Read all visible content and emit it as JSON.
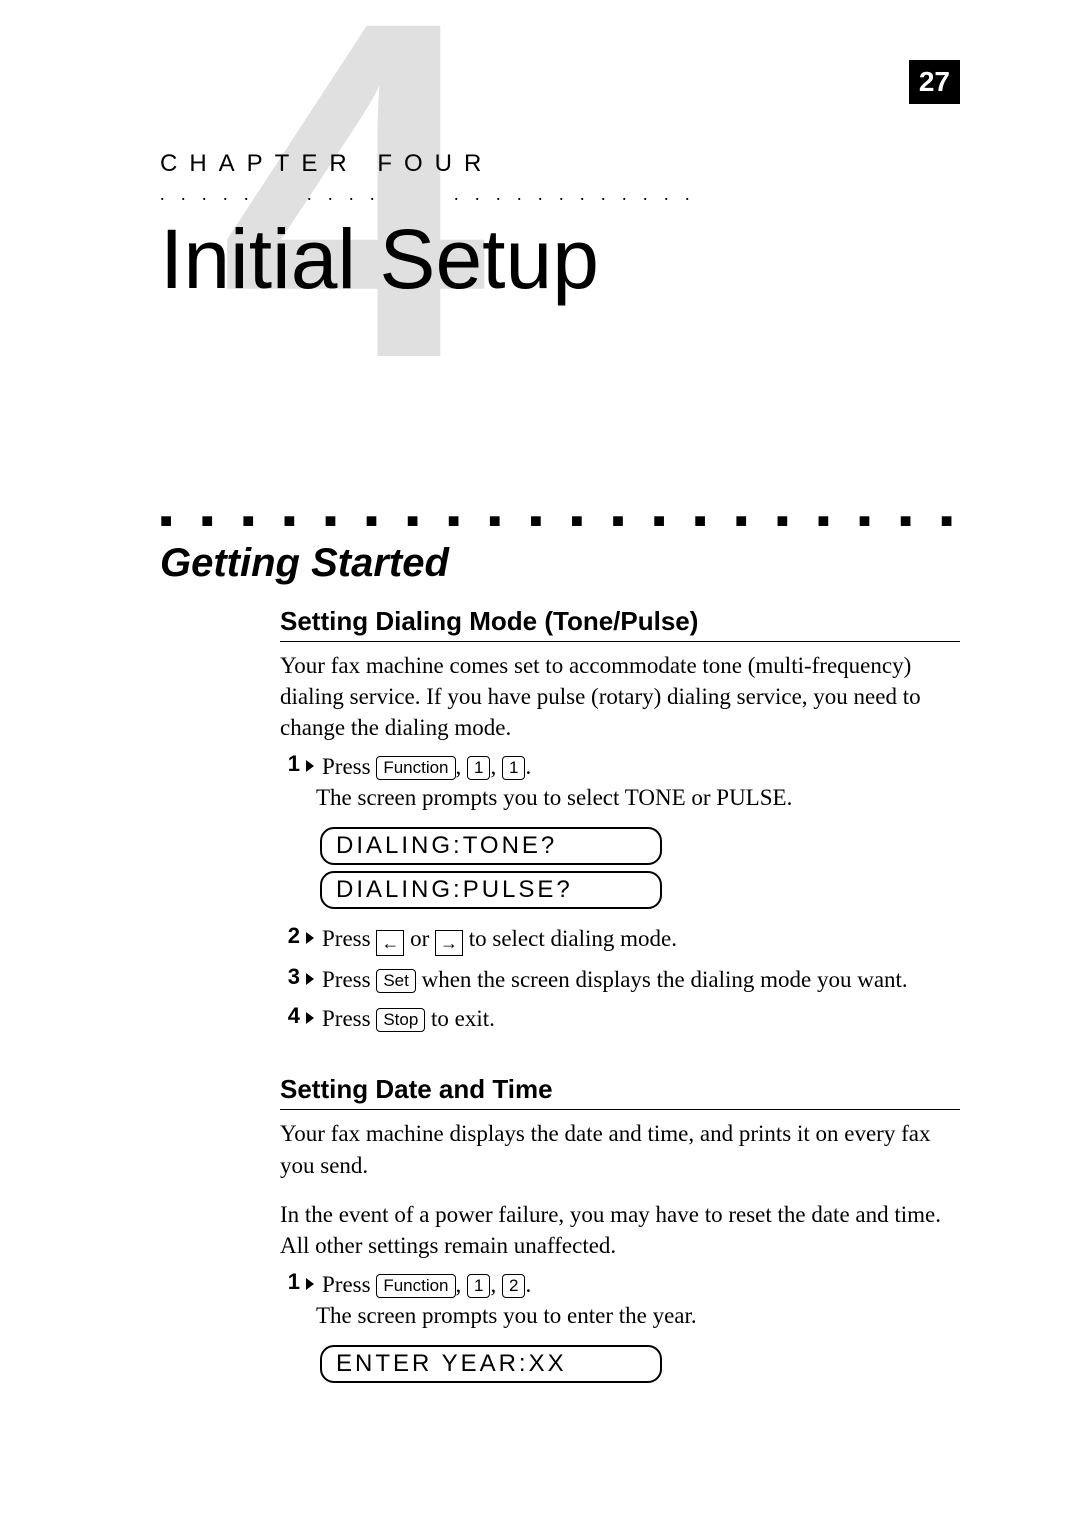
{
  "page_number": "27",
  "chapter": {
    "big_number": "4",
    "label": "CHAPTER FOUR",
    "title": "Initial Setup"
  },
  "section": {
    "title": "Getting Started",
    "sub1": {
      "title": "Setting Dialing Mode (Tone/Pulse)",
      "intro": "Your fax machine comes set to accommodate tone (multi-frequency) dialing service. If you have pulse (rotary) dialing service, you need to change the dialing mode.",
      "step1_press": "Press",
      "key_function": "Function",
      "key_1": "1",
      "step1_prompt": "The screen prompts you to select TONE or PULSE.",
      "lcd1": "DIALING:TONE?",
      "lcd2": "DIALING:PULSE?",
      "step2_a": "Press",
      "step2_b": "or",
      "step2_c": "to select dialing mode.",
      "step3_a": "Press",
      "key_set": "Set",
      "step3_b": "when the screen displays the dialing mode you want.",
      "step4_a": "Press",
      "key_stop": "Stop",
      "step4_b": "to exit."
    },
    "sub2": {
      "title": "Setting Date and Time",
      "p1": "Your fax machine displays the date and time, and prints it on every fax you send.",
      "p2": "In the event of a power failure, you may have to reset the date and time. All other settings remain unaffected.",
      "step1_press": "Press",
      "key_2": "2",
      "step1_prompt": "The screen prompts you to enter the year.",
      "lcd1": "ENTER YEAR:XX"
    }
  },
  "nums": {
    "n1": "1",
    "n2": "2",
    "n3": "3",
    "n4": "4"
  },
  "punct": {
    "comma": ",",
    "period": "."
  },
  "arrows": {
    "left": "←",
    "right": "→"
  }
}
